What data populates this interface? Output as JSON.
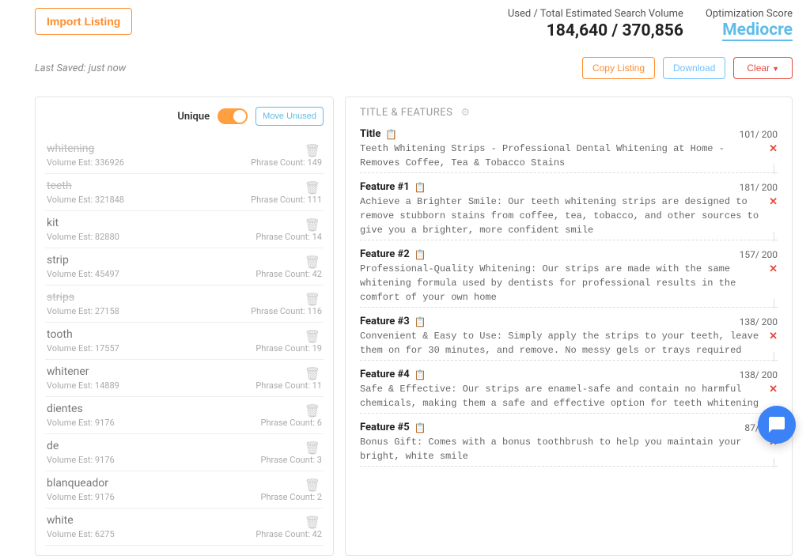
{
  "header": {
    "import_label": "Import Listing",
    "volume_label": "Used / Total Estimated Search Volume",
    "volume_value": "184,640 / 370,856",
    "score_label": "Optimization Score",
    "score_value": "Mediocre"
  },
  "row2": {
    "last_saved": "Last Saved: just now",
    "copy_label": "Copy Listing",
    "download_label": "Download",
    "clear_label": "Clear"
  },
  "keywords_panel": {
    "unique_label": "Unique",
    "move_label": "Move Unused",
    "items": [
      {
        "name": "whitening",
        "vol": "Volume Est: 336926",
        "count": "Phrase Count: 149",
        "struck": true
      },
      {
        "name": "teeth",
        "vol": "Volume Est: 321848",
        "count": "Phrase Count: 111",
        "struck": true
      },
      {
        "name": "kit",
        "vol": "Volume Est: 82880",
        "count": "Phrase Count: 14",
        "struck": false
      },
      {
        "name": "strip",
        "vol": "Volume Est: 45497",
        "count": "Phrase Count: 42",
        "struck": false
      },
      {
        "name": "strips",
        "vol": "Volume Est: 27158",
        "count": "Phrase Count: 116",
        "struck": true
      },
      {
        "name": "tooth",
        "vol": "Volume Est: 17557",
        "count": "Phrase Count: 19",
        "struck": false
      },
      {
        "name": "whitener",
        "vol": "Volume Est: 14889",
        "count": "Phrase Count: 11",
        "struck": false
      },
      {
        "name": "dientes",
        "vol": "Volume Est: 9176",
        "count": "Phrase Count: 6",
        "struck": false
      },
      {
        "name": "de",
        "vol": "Volume Est: 9176",
        "count": "Phrase Count: 3",
        "struck": false
      },
      {
        "name": "blanqueador",
        "vol": "Volume Est: 9176",
        "count": "Phrase Count: 2",
        "struck": false
      },
      {
        "name": "white",
        "vol": "Volume Est: 6275",
        "count": "Phrase Count: 42",
        "struck": false
      }
    ]
  },
  "features_panel": {
    "header": "TITLE & FEATURES",
    "rows": [
      {
        "label": "Title",
        "count": "101/ 200",
        "text": "Teeth Whitening Strips - Professional Dental Whitening at Home - Removes Coffee, Tea & Tobacco Stains"
      },
      {
        "label": "Feature #1",
        "count": "181/ 200",
        "text": "Achieve a Brighter Smile: Our teeth whitening strips are designed to remove stubborn stains from coffee, tea, tobacco, and other sources to give you a brighter, more confident smile"
      },
      {
        "label": "Feature #2",
        "count": "157/ 200",
        "text": "Professional-Quality Whitening: Our strips are made with the same whitening formula used by dentists for professional results in the comfort of your own home"
      },
      {
        "label": "Feature #3",
        "count": "138/ 200",
        "text": "Convenient & Easy to Use: Simply apply the strips to your teeth, leave them on for 30 minutes, and remove. No messy gels or trays required"
      },
      {
        "label": "Feature #4",
        "count": "138/ 200",
        "text": "Safe & Effective: Our strips are enamel-safe and contain no harmful chemicals, making them a safe and effective option for teeth whitening"
      },
      {
        "label": "Feature #5",
        "count": "87/ 200",
        "text": "Bonus Gift: Comes with a bonus toothbrush to help you maintain your bright, white smile"
      }
    ]
  }
}
